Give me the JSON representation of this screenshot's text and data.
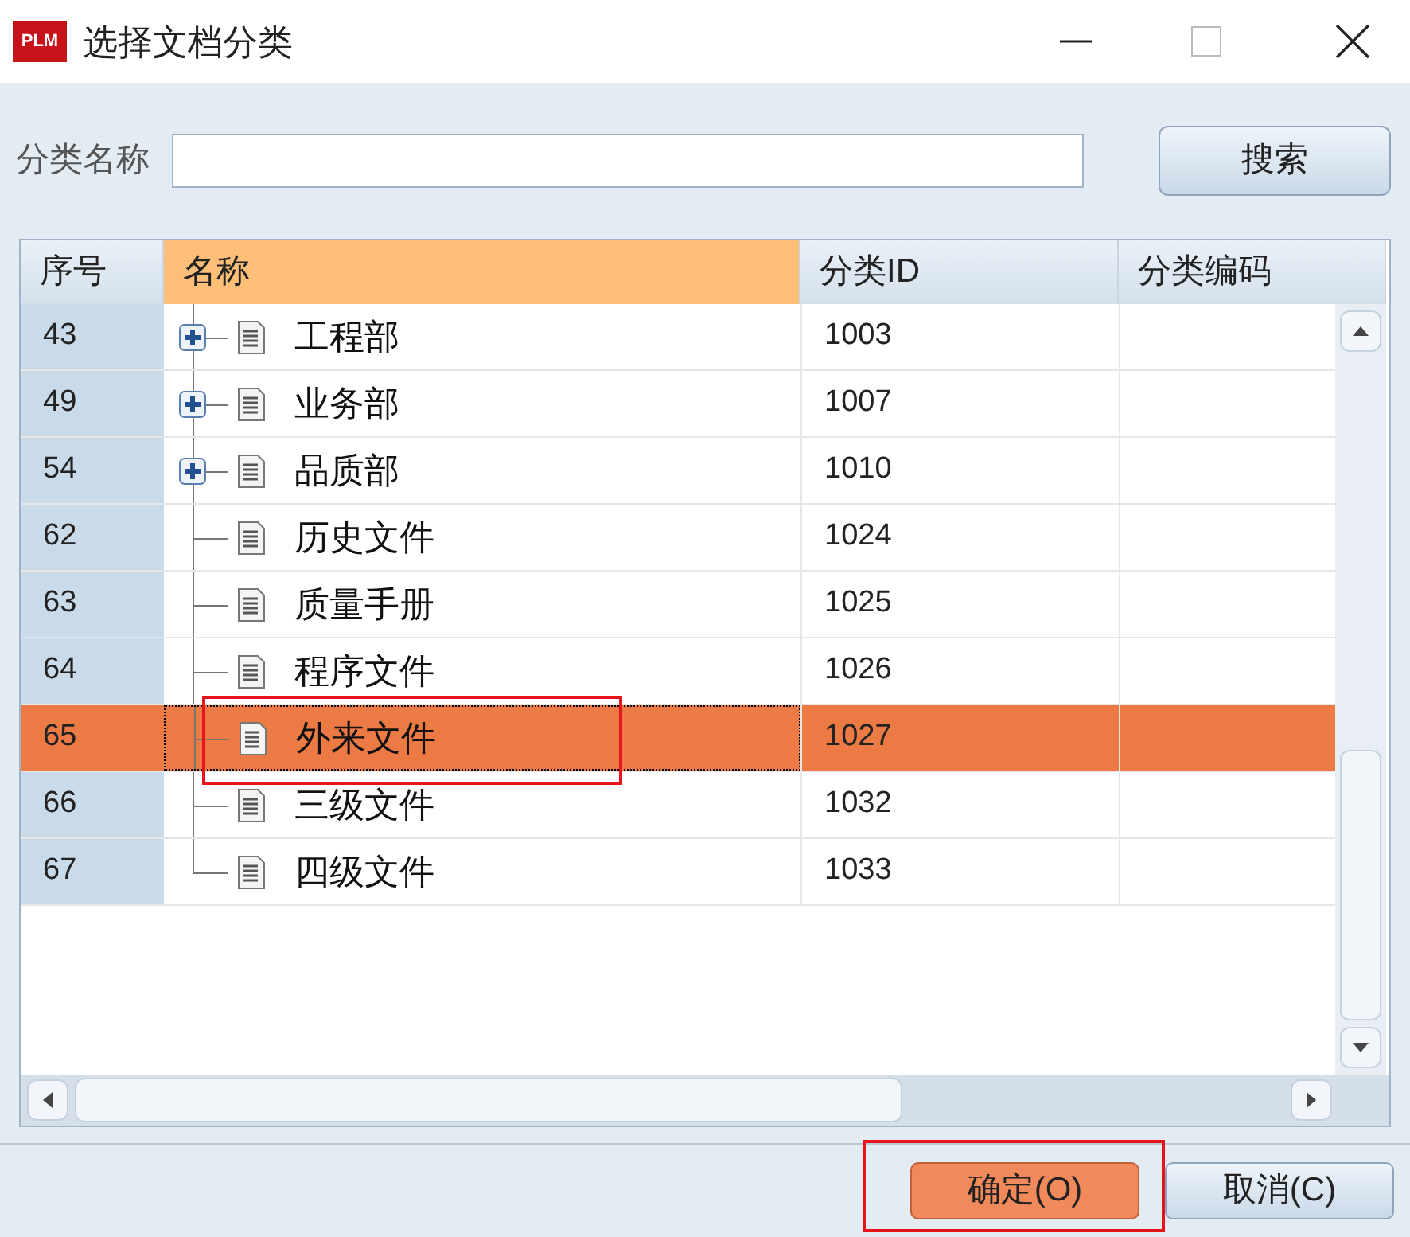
{
  "window": {
    "title": "选择文档分类",
    "logo": "PLM"
  },
  "search": {
    "label": "分类名称",
    "button": "搜索"
  },
  "table": {
    "columns": [
      {
        "label": "序号",
        "selected": false
      },
      {
        "label": "名称",
        "selected": true
      },
      {
        "label": "分类ID",
        "selected": false
      },
      {
        "label": "分类编码",
        "selected": false
      }
    ],
    "rows": [
      {
        "index": "43",
        "name": "工程部",
        "id": "1003",
        "code": "",
        "expandable": true,
        "selected": false,
        "annotated": false
      },
      {
        "index": "49",
        "name": "业务部",
        "id": "1007",
        "code": "",
        "expandable": true,
        "selected": false,
        "annotated": false
      },
      {
        "index": "54",
        "name": "品质部",
        "id": "1010",
        "code": "",
        "expandable": true,
        "selected": false,
        "annotated": false
      },
      {
        "index": "62",
        "name": "历史文件",
        "id": "1024",
        "code": "",
        "expandable": false,
        "selected": false,
        "annotated": false
      },
      {
        "index": "63",
        "name": "质量手册",
        "id": "1025",
        "code": "",
        "expandable": false,
        "selected": false,
        "annotated": false
      },
      {
        "index": "64",
        "name": "程序文件",
        "id": "1026",
        "code": "",
        "expandable": false,
        "selected": false,
        "annotated": false
      },
      {
        "index": "65",
        "name": "外来文件",
        "id": "1027",
        "code": "",
        "expandable": false,
        "selected": true,
        "annotated": true
      },
      {
        "index": "66",
        "name": "三级文件",
        "id": "1032",
        "code": "",
        "expandable": false,
        "selected": false,
        "annotated": false
      },
      {
        "index": "67",
        "name": "四级文件",
        "id": "1033",
        "code": "",
        "expandable": false,
        "selected": false,
        "annotated": false
      }
    ]
  },
  "buttons": [
    {
      "label": "确定(O)",
      "primary": true,
      "annotated": true
    },
    {
      "label": "取消(C)",
      "primary": false,
      "annotated": false
    }
  ]
}
